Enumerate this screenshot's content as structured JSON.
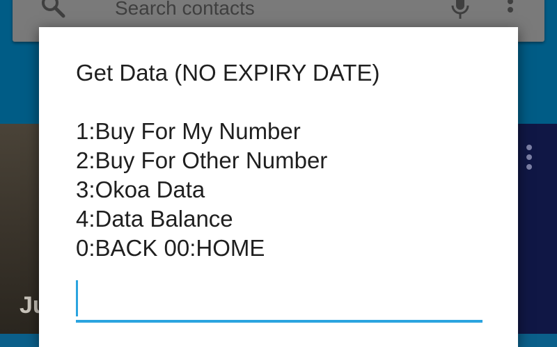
{
  "background_app": {
    "search_placeholder": "Search contacts",
    "icons": {
      "search": "search-icon",
      "mic": "mic-icon",
      "overflow": "overflow-menu-icon"
    },
    "card_left_text": "Ju"
  },
  "dialog": {
    "title": "Get Data (NO EXPIRY DATE)",
    "menu_items": [
      "1:Buy For My Number",
      "2:Buy For Other Number",
      "3:Okoa Data",
      "4:Data Balance",
      "0:BACK 00:HOME"
    ],
    "reply_value": ""
  },
  "colors": {
    "accent": "#2ba4df",
    "appbar": "#005c86",
    "searchbar": "#7a7a7a",
    "dialog_bg": "#ffffff"
  }
}
